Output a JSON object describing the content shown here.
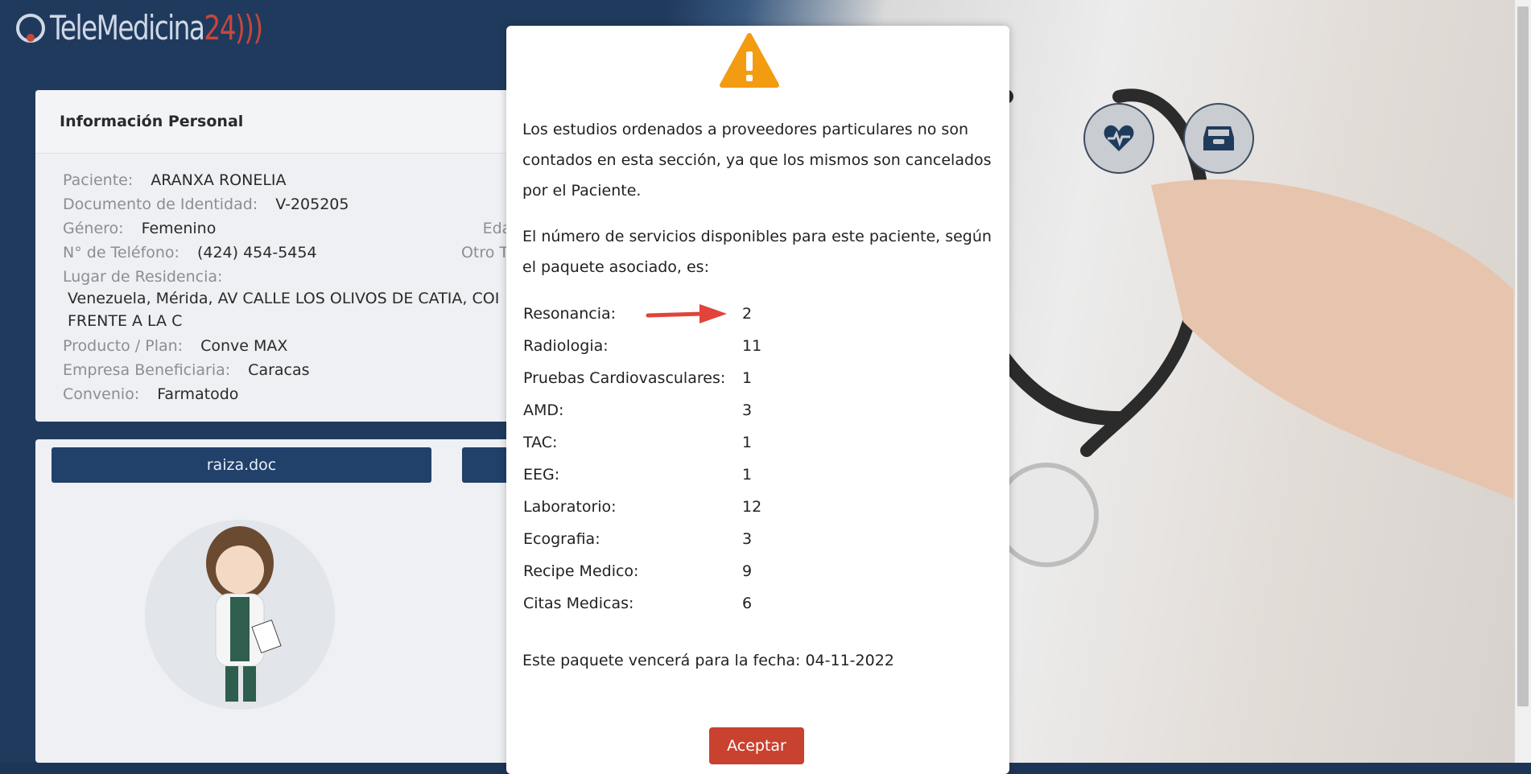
{
  "app": {
    "logo_text_main": "TeleMedicina",
    "logo_text_num": "24"
  },
  "personal_info": {
    "title": "Información Personal",
    "patient_label": "Paciente:",
    "patient_value": "ARANXA RONELIA",
    "document_label": "Documento de Identidad:",
    "document_value": "V-205205",
    "gender_label": "Género:",
    "gender_value": "Femenino",
    "age_label": "Edad",
    "phone_label": "N° de Teléfono:",
    "phone_value": "(424) 454-5454",
    "other_label": "Otro T",
    "residence_label": "Lugar de Residencia:",
    "address_line1": "Venezuela, Mérida, AV CALLE LOS OLIVOS DE CATIA, COI",
    "address_line2": "FRENTE A LA C",
    "plan_label": "Producto / Plan:",
    "plan_value": "Conve MAX",
    "company_label": "Empresa Beneficiaria:",
    "company_value": "Caracas",
    "agreement_label": "Convenio:",
    "agreement_value": "Farmatodo"
  },
  "documents": {
    "doc_button_label": "raiza.doc",
    "second_button_label": ""
  },
  "modal": {
    "paragraph1": "Los estudios ordenados a proveedores particulares no son contados en esta sección, ya que los mismos son cancelados por el Paciente.",
    "paragraph2": "El número de servicios disponibles para este paciente, según el paquete asociado, es:",
    "services": [
      {
        "name": "Resonancia:",
        "value": "2"
      },
      {
        "name": "Radiologia:",
        "value": "11"
      },
      {
        "name": "Pruebas Cardiovasculares:",
        "value": "1"
      },
      {
        "name": "AMD:",
        "value": "3"
      },
      {
        "name": "TAC:",
        "value": "1"
      },
      {
        "name": "EEG:",
        "value": "1"
      },
      {
        "name": "Laboratorio:",
        "value": "12"
      },
      {
        "name": "Ecografia:",
        "value": "3"
      },
      {
        "name": "Recipe Medico:",
        "value": "9"
      },
      {
        "name": "Citas Medicas:",
        "value": "6"
      }
    ],
    "expiry_text": "Este paquete vencerá para la fecha: 04-11-2022",
    "accept_label": "Aceptar",
    "warning_icon": "warning-icon",
    "accent_color": "#c9412f",
    "warning_color": "#f39c12"
  },
  "icons": {
    "heart_button": "heartbeat-icon",
    "archive_button": "archive-icon"
  }
}
